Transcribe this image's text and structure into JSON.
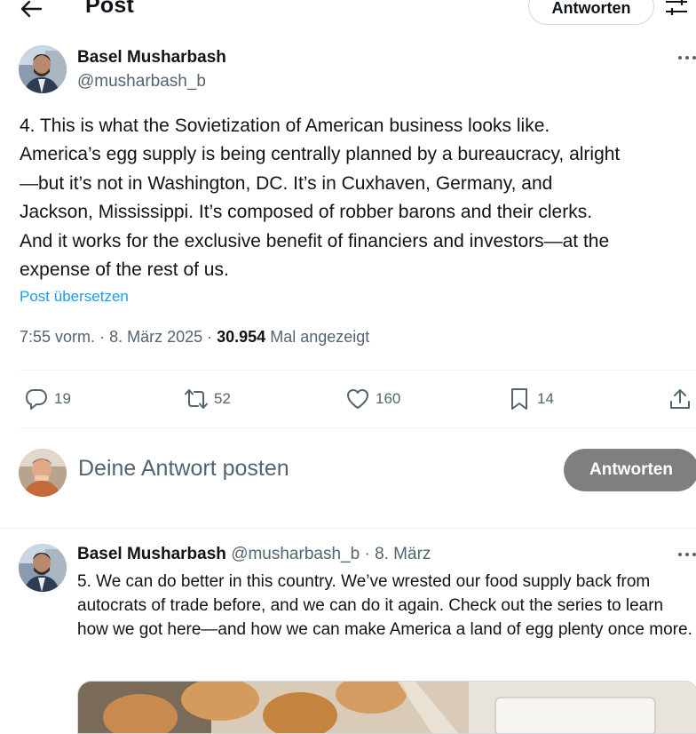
{
  "header": {
    "title": "Post",
    "reply_button_label": "Antworten"
  },
  "post": {
    "author_name": "Basel Musharbash",
    "author_handle": "@musharbash_b",
    "text": "4. This is what the Sovietization of American business looks like.\nAmerica’s egg supply is being centrally planned by a bureaucracy, alright\n—but it’s not in Washington, DC. It’s in Cuxhaven, Germany, and\nJackson, Mississippi. It’s composed of robber barons and their clerks.\nAnd it works for the exclusive benefit of financiers and investors—at the\nexpense of the rest of us.",
    "translate_label": "Post übersetzen",
    "time": "7:55 vorm.",
    "date": "8. März 2025",
    "views_count": "30.954",
    "views_label": "Mal angezeigt",
    "stats": {
      "replies": "19",
      "reposts": "52",
      "likes": "160",
      "bookmarks": "14"
    }
  },
  "composer": {
    "placeholder": "Deine Antwort posten",
    "button_label": "Antworten"
  },
  "thread_reply": {
    "author_name": "Basel Musharbash",
    "author_handle": "@musharbash_b",
    "separator": "·",
    "date": "8. März",
    "text": "5. We can do better in this country. We’ve wrested our food supply back from autocrats of trade before, and we can do it again. Check out the series to learn how we got here—and how we can make America a land of egg plenty once more."
  },
  "colors": {
    "text_primary": "#0f1419",
    "text_secondary": "#536471",
    "link": "#1d9bf0",
    "divider": "#eff3f4",
    "composer_button": "#7f7f7f"
  },
  "icons": [
    "back-arrow-icon",
    "settings-sliders-icon",
    "more-dots-icon",
    "reply-icon",
    "repost-icon",
    "like-heart-icon",
    "bookmark-icon",
    "share-icon"
  ]
}
